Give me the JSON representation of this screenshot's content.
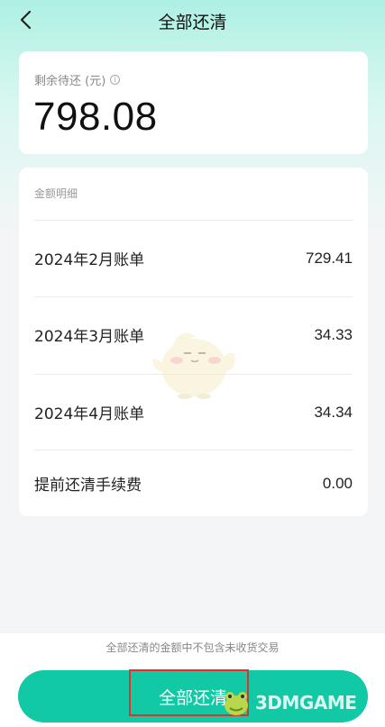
{
  "nav": {
    "title": "全部还清",
    "back_icon": "chevron-left-icon"
  },
  "summary": {
    "label": "剩余待还 (元)",
    "info_icon": "info-icon",
    "amount": "798.08"
  },
  "detail": {
    "header": "金额明细",
    "rows": [
      {
        "label": "2024年2月账单",
        "value": "729.41"
      },
      {
        "label": "2024年3月账单",
        "value": "34.33"
      },
      {
        "label": "2024年4月账单",
        "value": "34.34"
      },
      {
        "label": "提前还清手续费",
        "value": "0.00"
      }
    ]
  },
  "footer": {
    "notice": "全部还清的金额中不包含未收货交易",
    "pay_button": "全部还清"
  },
  "watermark": {
    "text": "3DMGAME"
  },
  "colors": {
    "accent": "#12c9a6",
    "highlight": "#e0312b",
    "header_gradient": "#aef0e3"
  }
}
